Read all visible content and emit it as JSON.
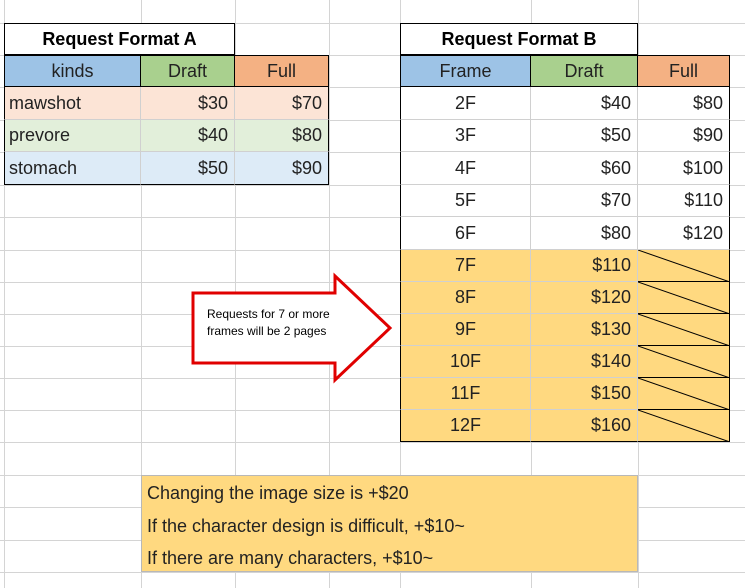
{
  "tableA": {
    "title": "Request Format A",
    "headers": [
      "kinds",
      "Draft",
      "Full"
    ],
    "rows": [
      [
        "mawshot",
        "$30",
        "$70"
      ],
      [
        "prevore",
        "$40",
        "$80"
      ],
      [
        "stomach",
        "$50",
        "$90"
      ]
    ]
  },
  "tableB": {
    "title": "Request Format B",
    "headers": [
      "Frame",
      "Draft",
      "Full"
    ],
    "rows": [
      [
        "2F",
        "$40",
        "$80"
      ],
      [
        "3F",
        "$50",
        "$90"
      ],
      [
        "4F",
        "$60",
        "$100"
      ],
      [
        "5F",
        "$70",
        "$110"
      ],
      [
        "6F",
        "$80",
        "$120"
      ],
      [
        "7F",
        "$110",
        ""
      ],
      [
        "8F",
        "$120",
        ""
      ],
      [
        "9F",
        "$130",
        ""
      ],
      [
        "10F",
        "$140",
        ""
      ],
      [
        "11F",
        "$150",
        ""
      ],
      [
        "12F",
        "$160",
        ""
      ]
    ]
  },
  "callout": {
    "line1": "Requests for 7 or more",
    "line2": "frames will be 2 pages"
  },
  "notes": [
    "Changing the image size is +$20",
    "If the character design is difficult, +$10~",
    "If there are many characters, +$10~"
  ],
  "colors": {
    "header_blue": "#9dc3e6",
    "header_green": "#a9d08e",
    "header_orange": "#f4b183",
    "row_orange": "#fce4d6",
    "row_green": "#e2efda",
    "row_blue": "#ddebf7",
    "highlight": "#ffd980",
    "arrow": "#e00000"
  }
}
